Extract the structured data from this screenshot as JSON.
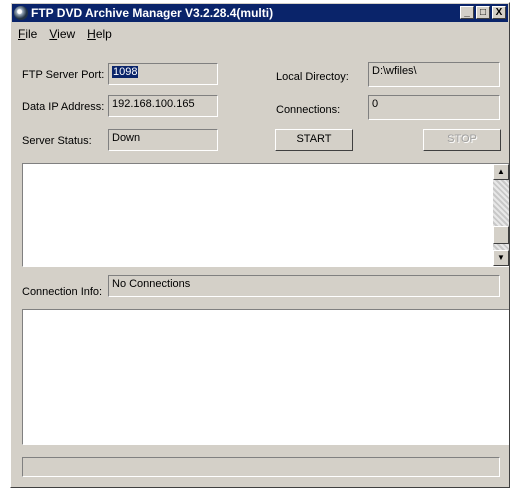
{
  "window": {
    "title": "FTP DVD Archive Manager V3.2.28.4(multi)",
    "minimize": "_",
    "maximize": "□",
    "close": "X"
  },
  "menu": {
    "file": {
      "hot": "F",
      "rest": "ile"
    },
    "view": {
      "hot": "V",
      "rest": "iew"
    },
    "help": {
      "hot": "H",
      "rest": "elp"
    }
  },
  "form": {
    "port_label": "FTP Server Port:",
    "port_value": "1098",
    "ip_label": "Data IP Address:",
    "ip_value": "192.168.100.165",
    "status_label": "Server Status:",
    "status_value": "Down",
    "local_dir_label": "Local Directoy:",
    "local_dir_value": "D:\\wfiles\\",
    "connections_label": "Connections:",
    "connections_value": "0"
  },
  "buttons": {
    "start": "START",
    "stop": "STOP"
  },
  "log": {
    "scroll_up": "▲",
    "scroll_down": "▼"
  },
  "connection_info": {
    "label": "Connection Info:",
    "value": "No Connections"
  },
  "status_bar": {
    "text": ""
  },
  "colors": {
    "titlebar": "#0a246a",
    "face": "#d4d0c8"
  }
}
